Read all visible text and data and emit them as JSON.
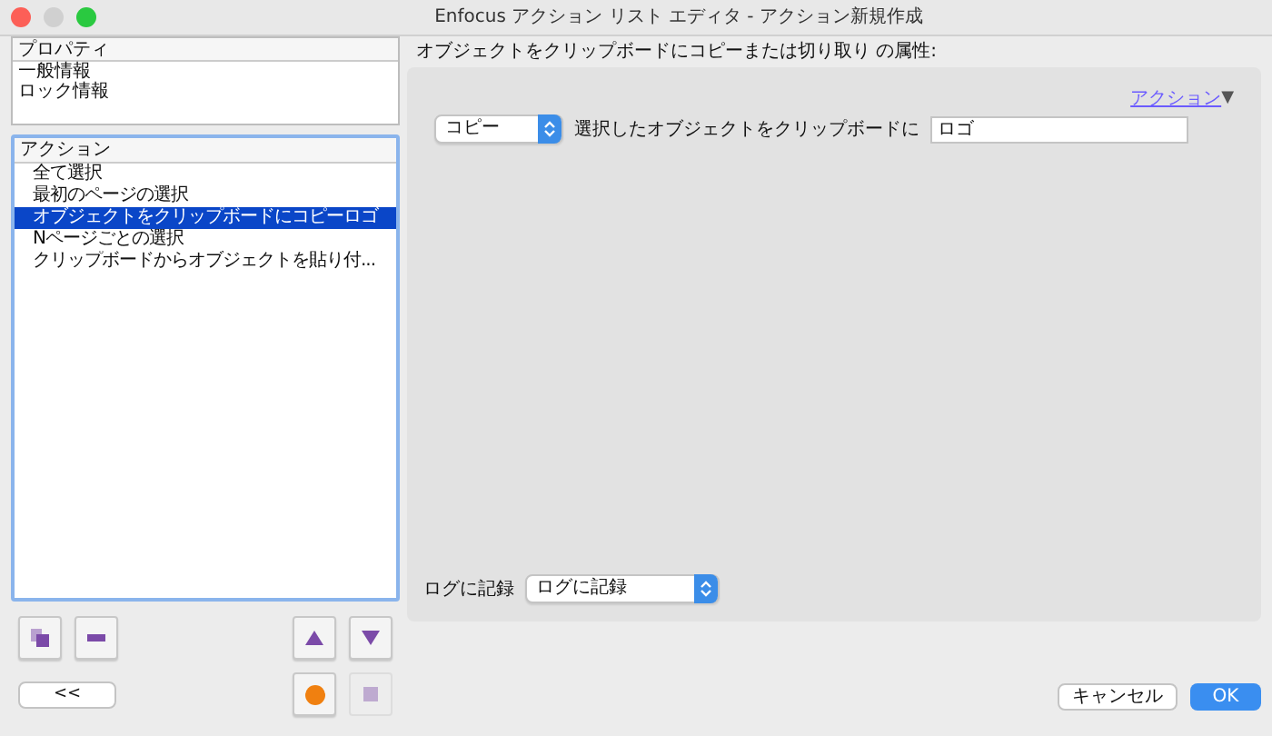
{
  "window": {
    "title": "Enfocus アクション リスト エディタ - アクション新規作成"
  },
  "properties": {
    "header": "プロパティ",
    "items": [
      {
        "label": "一般情報",
        "selected": false
      },
      {
        "label": "ロック情報",
        "selected": false
      }
    ]
  },
  "actions": {
    "header": "アクション",
    "items": [
      {
        "label": "全て選択",
        "selected": false
      },
      {
        "label": "最初のページの選択",
        "selected": false
      },
      {
        "label": "オブジェクトをクリップボードにコピーロゴ",
        "selected": true
      },
      {
        "label": "Nページごとの選択",
        "selected": false
      },
      {
        "label": "クリップボードからオブジェクトを貼り付...",
        "selected": false
      }
    ]
  },
  "toolbar": [
    {
      "kind": "duplicate",
      "disabled": false
    },
    {
      "kind": "remove",
      "disabled": false
    },
    {
      "kind": "up",
      "disabled": false
    },
    {
      "kind": "down",
      "disabled": false
    },
    {
      "kind": "record",
      "disabled": false
    },
    {
      "kind": "stop",
      "disabled": true
    }
  ],
  "collapse_button": "<<",
  "panel": {
    "heading": "オブジェクトをクリップボードにコピーまたは切り取り の属性:",
    "mode_select": {
      "value": "コピー"
    },
    "target_label": "選択したオブジェクトをクリップボードに",
    "target_field": {
      "value": "ロゴ"
    },
    "actions_menu": {
      "label": "アクション",
      "arrow": "▼"
    },
    "log_label": "ログに記録",
    "log_select": {
      "value": "ログに記録"
    }
  },
  "buttons": [
    {
      "label": "キャンセル",
      "default": false
    },
    {
      "label": "OK",
      "default": true
    }
  ]
}
